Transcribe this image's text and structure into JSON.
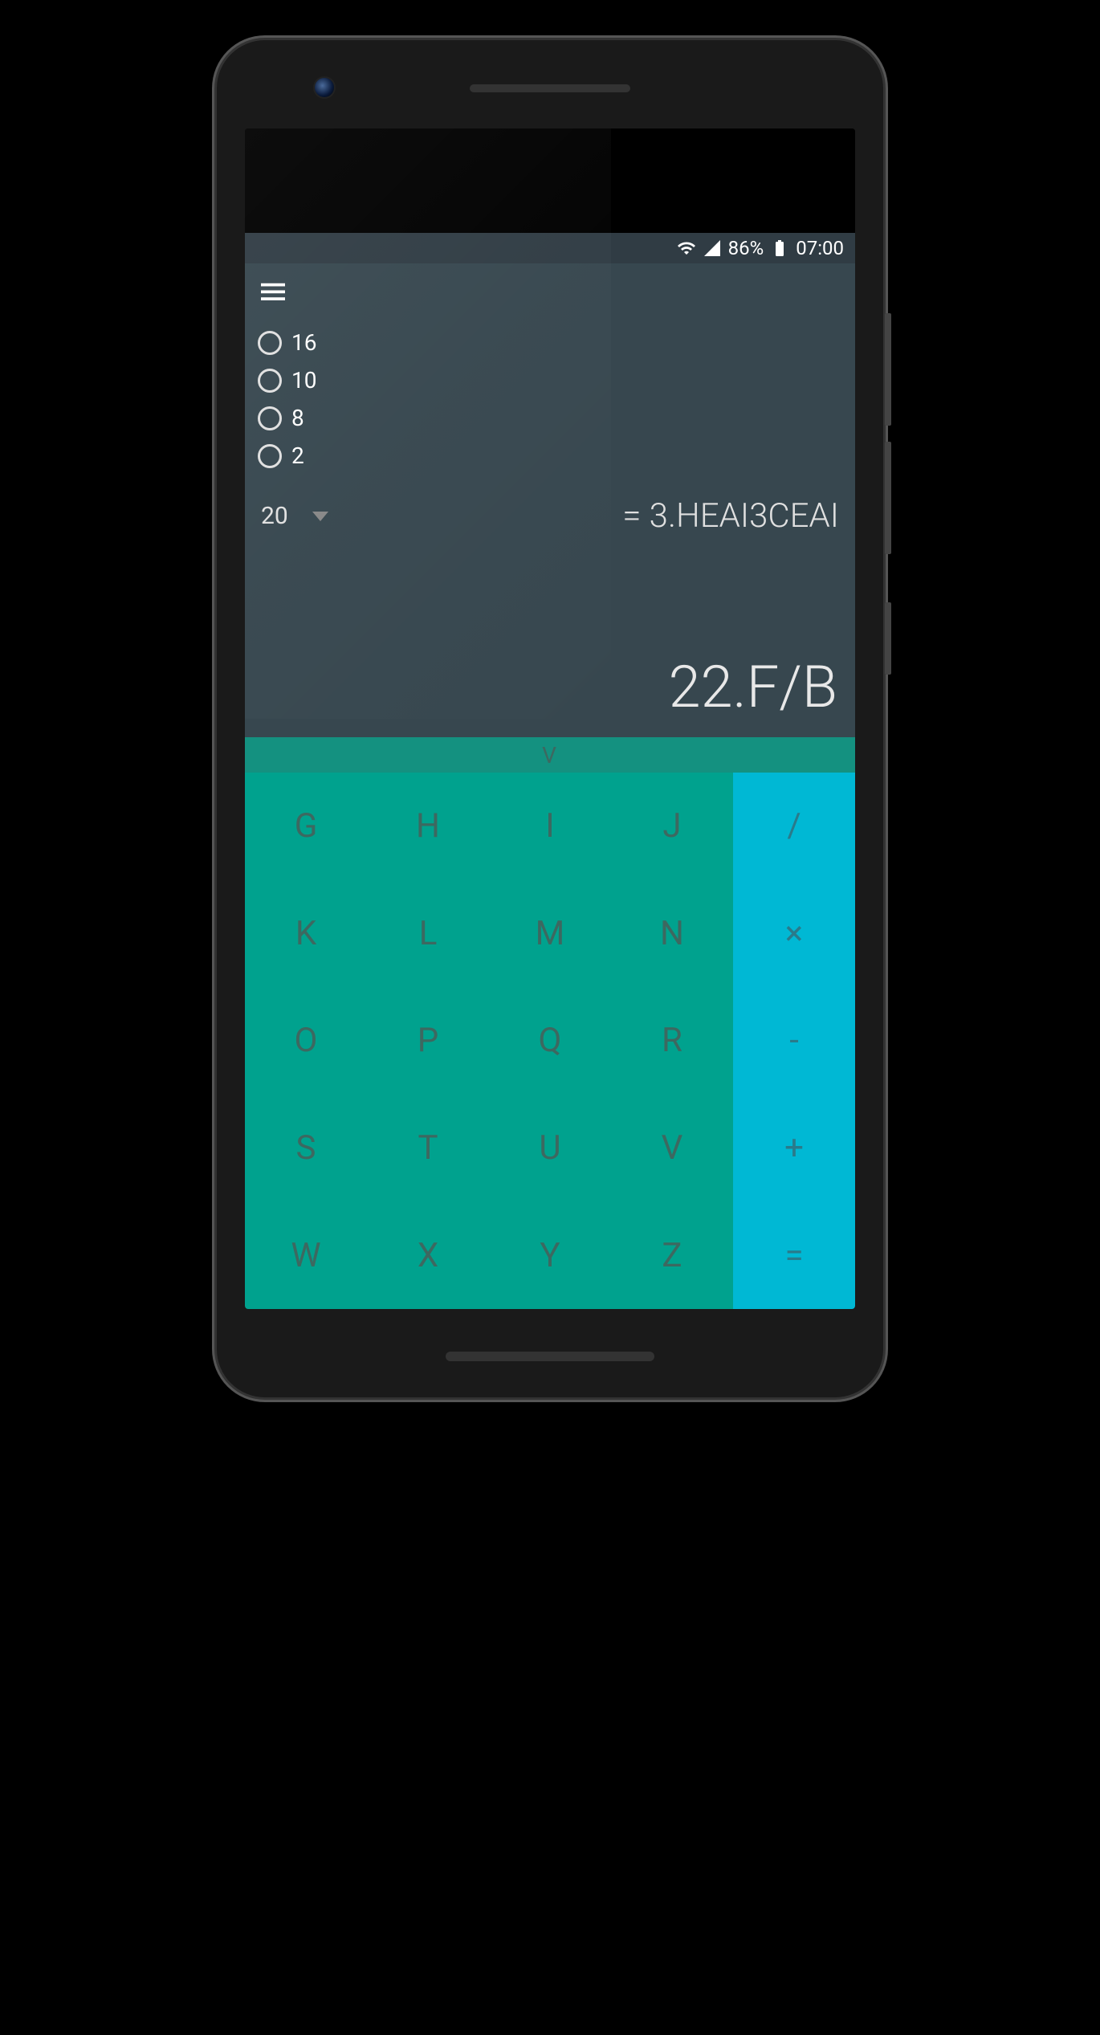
{
  "status_bar": {
    "battery_percent": "86%",
    "time": "07:00"
  },
  "radio_options": [
    {
      "label": "16"
    },
    {
      "label": "10"
    },
    {
      "label": "8"
    },
    {
      "label": "2"
    }
  ],
  "base_selector": {
    "value": "20"
  },
  "display": {
    "result": "= 3.HEAI3CEAI",
    "expression": "22.F/B"
  },
  "divider_label": "V",
  "keypad": {
    "letters": [
      [
        "G",
        "H",
        "I",
        "J"
      ],
      [
        "K",
        "L",
        "M",
        "N"
      ],
      [
        "O",
        "P",
        "Q",
        "R"
      ],
      [
        "S",
        "T",
        "U",
        "V"
      ],
      [
        "W",
        "X",
        "Y",
        "Z"
      ]
    ],
    "operators": [
      "/",
      "×",
      "-",
      "+",
      "="
    ]
  }
}
